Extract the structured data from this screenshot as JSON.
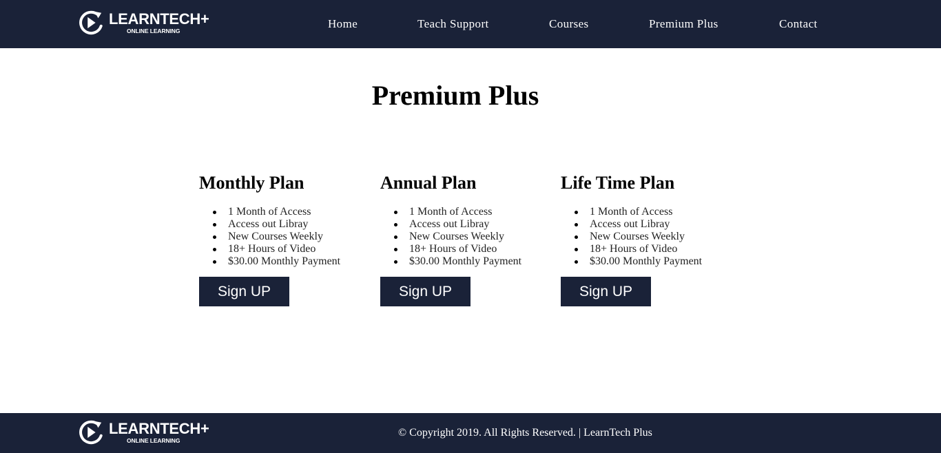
{
  "brand": {
    "name": "LEARNTECH+",
    "tagline": "ONLINE LEARNING"
  },
  "nav": [
    {
      "label": "Home"
    },
    {
      "label": "Teach Support"
    },
    {
      "label": "Courses"
    },
    {
      "label": "Premium Plus"
    },
    {
      "label": "Contact"
    }
  ],
  "page_title": "Premium Plus",
  "plans": [
    {
      "title": "Monthly Plan",
      "features": [
        "1 Month of Access",
        "Access out Libray",
        "New Courses Weekly",
        "18+ Hours of Video",
        "$30.00 Monthly Payment"
      ],
      "button": "Sign UP"
    },
    {
      "title": "Annual Plan",
      "features": [
        "1 Month of Access",
        "Access out Libray",
        "New Courses Weekly",
        "18+ Hours of Video",
        "$30.00 Monthly Payment"
      ],
      "button": "Sign UP"
    },
    {
      "title": "Life Time Plan",
      "features": [
        "1 Month of Access",
        "Access out Libray",
        "New Courses Weekly",
        "18+ Hours of Video",
        "$30.00 Monthly Payment"
      ],
      "button": "Sign UP"
    }
  ],
  "footer": {
    "copyright": "© Copyright 2019. All Rights Reserved. | LearnTech Plus"
  },
  "colors": {
    "navy": "#1a2238",
    "text": "#222222",
    "white": "#ffffff"
  }
}
